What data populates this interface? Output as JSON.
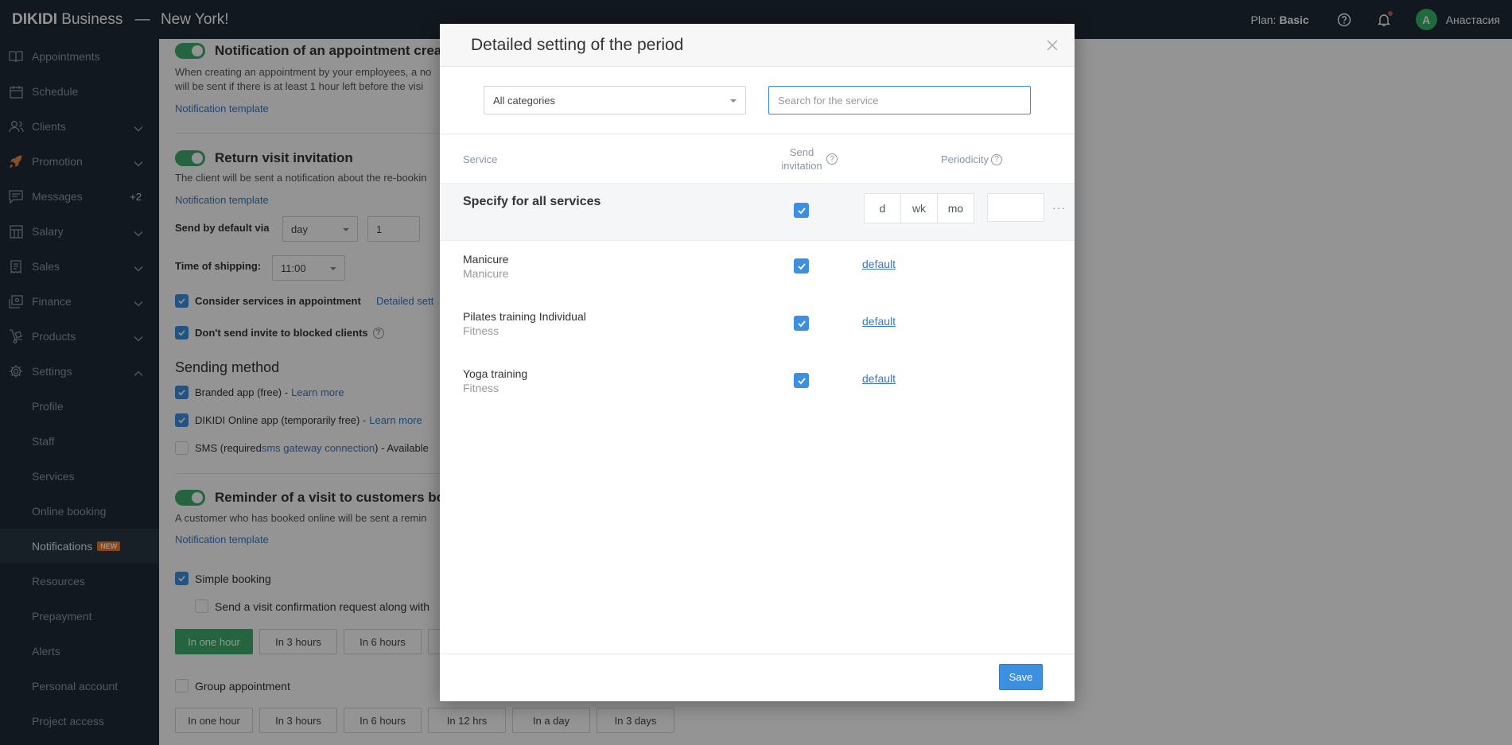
{
  "header": {
    "brand": "DIKIDI",
    "brand_suffix": "Business",
    "separator": "—",
    "city": "New York!",
    "plan_label": "Plan:",
    "plan_value": "Basic",
    "avatar_letter": "A",
    "username": "Анастасия"
  },
  "sidebar": {
    "items": [
      {
        "label": "Appointments"
      },
      {
        "label": "Schedule"
      },
      {
        "label": "Clients"
      },
      {
        "label": "Promotion"
      },
      {
        "label": "Messages",
        "badge": "+2"
      },
      {
        "label": "Salary"
      },
      {
        "label": "Sales"
      },
      {
        "label": "Finance"
      },
      {
        "label": "Products"
      },
      {
        "label": "Settings"
      }
    ],
    "sub_items": [
      {
        "label": "Profile"
      },
      {
        "label": "Staff"
      },
      {
        "label": "Services"
      },
      {
        "label": "Online booking"
      },
      {
        "label": "Notifications",
        "badge": "NEW"
      },
      {
        "label": "Resources"
      },
      {
        "label": "Prepayment"
      },
      {
        "label": "Alerts"
      },
      {
        "label": "Personal account"
      },
      {
        "label": "Project access"
      }
    ]
  },
  "background": {
    "sec1_title": "Notification of an appointment crea",
    "sec1_desc1": "When creating an appointment by your employees, a no",
    "sec1_desc2": "will be sent if there is at least 1 hour left before the visi",
    "template_link": "Notification template",
    "sec2_title": "Return visit invitation",
    "sec2_desc": "The client will be sent a notification about the re-bookin",
    "send_default_label": "Send by default via",
    "send_default_unit": "day",
    "send_default_value": "1",
    "time_label": "Time of shipping:",
    "time_value": "11:00",
    "consider_label": "Consider services in appointment",
    "detailed_link": "Detailed sett",
    "dont_send_label": "Don't send invite to blocked clients",
    "help_q": "?",
    "sending_method": "Sending method",
    "branded_label": "Branded app (free) - ",
    "learn_more": "Learn more",
    "dikidi_label": "DIKIDI Online app (temporarily free) - ",
    "sms_label_1": "SMS (required ",
    "sms_link": "sms gateway connection",
    "sms_label_2": ") - Available",
    "sec3_title": "Reminder of a visit to customers bo",
    "sec3_desc": "A customer who has booked online will be sent a remin",
    "simple_booking": "Simple booking",
    "confirm_label": "Send a visit confirmation request along with",
    "chips1": [
      "In one hour",
      "In 3 hours",
      "In 6 hours"
    ],
    "group_label": "Group appointment",
    "chips2": [
      "In one hour",
      "In 3 hours",
      "In 6 hours",
      "In 12 hrs",
      "In a day",
      "In 3 days"
    ]
  },
  "modal": {
    "title": "Detailed setting of the period",
    "category_select": "All categories",
    "search_placeholder": "Search for the service",
    "col_service": "Service",
    "col_send_1": "Send",
    "col_send_2": "invitation",
    "col_periodicity": "Periodicity",
    "help_q": "?",
    "all_services": "Specify for all services",
    "units": [
      "d",
      "wk",
      "mo"
    ],
    "more": "···",
    "services": [
      {
        "name": "Manicure",
        "category": "Manicure",
        "period": "default"
      },
      {
        "name": "Pilates training Individual",
        "category": "Fitness",
        "period": "default"
      },
      {
        "name": "Yoga training",
        "category": "Fitness",
        "period": "default"
      }
    ],
    "save_label": "Save"
  },
  "colors": {
    "topbar": "#1f2a36",
    "accent_blue": "#3d8fe0",
    "accent_green": "#3fae6e",
    "link": "#3a78c3"
  }
}
